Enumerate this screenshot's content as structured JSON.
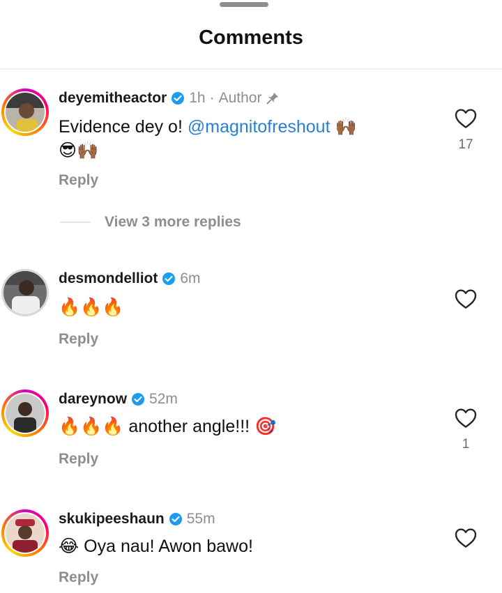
{
  "header": {
    "title": "Comments"
  },
  "comments": [
    {
      "username": "deyemitheactor",
      "time": "1h",
      "separator": "·",
      "role": "Author",
      "text": "Evidence dey o!",
      "mention": "@magnitofreshout",
      "emoji_line1": "🙌🏾",
      "emoji_line2": "😎🙌🏾",
      "reply": "Reply",
      "likes": "17"
    },
    {
      "username": "desmondelliot",
      "time": "6m",
      "text": "🔥🔥🔥",
      "reply": "Reply",
      "likes": ""
    },
    {
      "username": "dareynow",
      "time": "52m",
      "emojis": "🔥🔥🔥",
      "text": "another angle!!!",
      "emoji_end": "🎯",
      "reply": "Reply",
      "likes": "1"
    },
    {
      "username": "skukipeeshaun",
      "time": "55m",
      "emoji": "😂",
      "text": "Oya nau! Awon bawo!",
      "reply": "Reply",
      "likes": ""
    }
  ],
  "view_replies": "View 3 more replies",
  "icons": {
    "verified": "verified-badge-icon",
    "pin": "pin-icon",
    "like": "heart-outline-icon"
  },
  "colors": {
    "mention": "#2a7fd3",
    "verified": "#1d9bf0",
    "muted": "#8e8e8e"
  }
}
